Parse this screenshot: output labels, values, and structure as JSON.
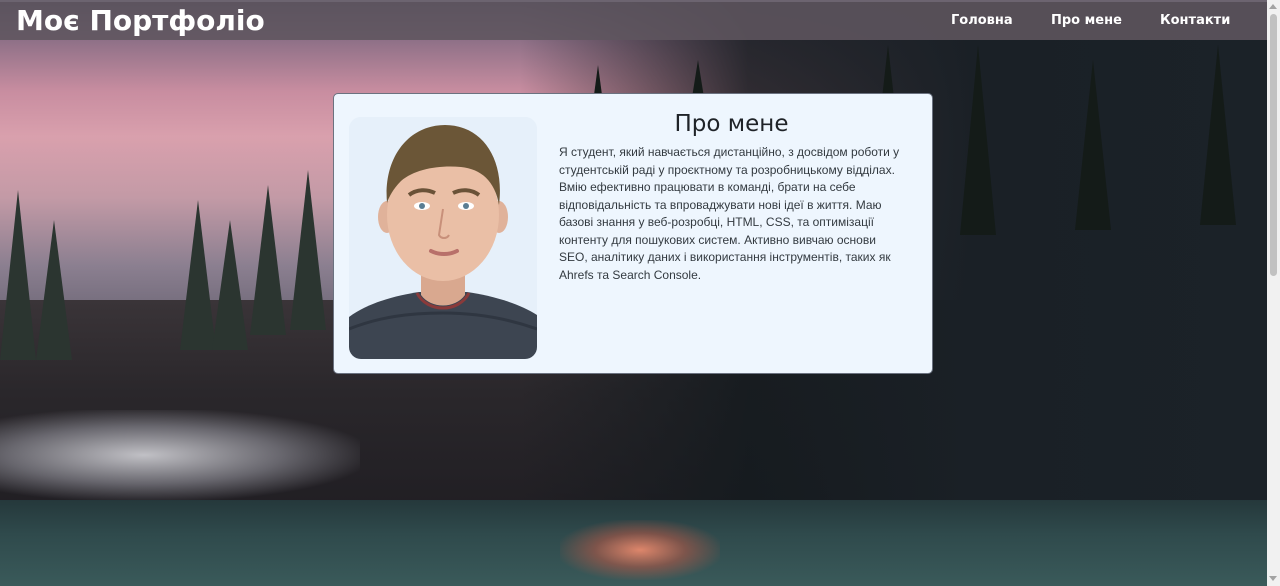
{
  "header": {
    "brand": "Моє Портфоліо",
    "nav": [
      "Головна",
      "Про мене",
      "Контакти"
    ]
  },
  "about": {
    "title": "Про мене",
    "text": "Я студент, який навчається дистанційно, з досвідом роботи у студентській раді у проєктному та розробницькому відділах. Вмію ефективно працювати в команді, брати на себе відповідальність та впроваджувати нові ідеї в життя. Маю базові знання у веб-розробці, HTML, CSS, та оптимізації контенту для пошукових систем. Активно вивчаю основи SEO, аналітику даних і використання інструментів, таких як Ahrefs та Search Console.",
    "photo_icon": "profile-photo"
  }
}
